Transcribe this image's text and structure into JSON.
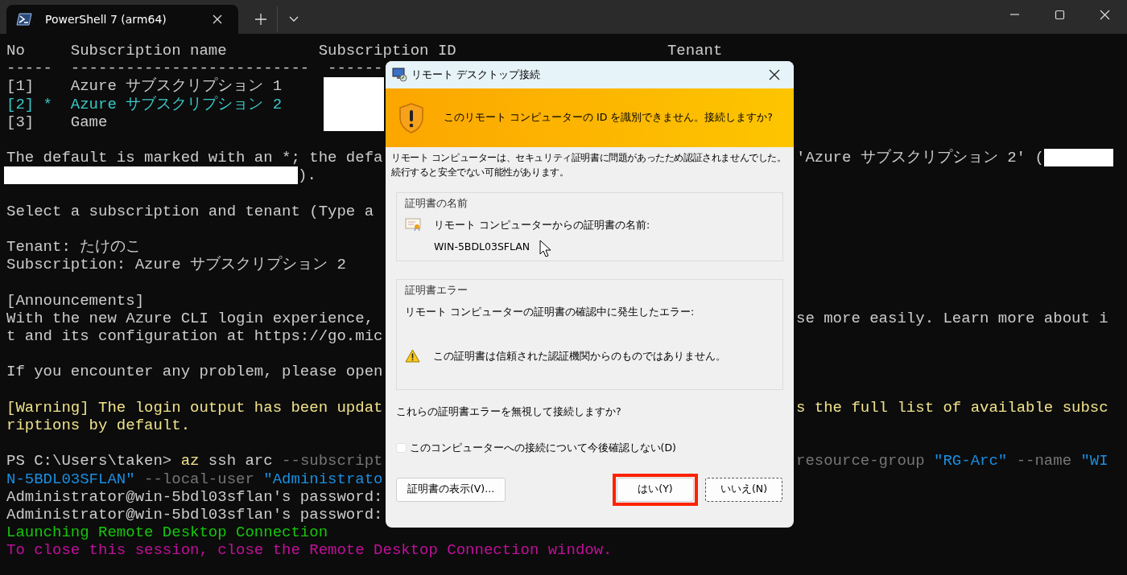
{
  "terminal": {
    "tabs": [
      {
        "title": "PowerShell 7 (arm64)",
        "selected": true
      }
    ],
    "blocks": [
      [
        {
          "left": [
            {
              "kind": "text",
              "color": "#cccccc",
              "text": "No     Subscription name          Subscription ID                       Tenant"
            }
          ]
        },
        {
          "left": [
            {
              "kind": "text",
              "color": "#cccccc",
              "text": "-----  --------------------------  ------"
            }
          ]
        },
        {
          "left": [
            {
              "kind": "text",
              "color": "#cccccc",
              "text": "[1]    Azure サブスクリプション 1"
            }
          ]
        },
        {
          "left": [
            {
              "kind": "text",
              "color": "#3ac8c8",
              "text": "[2] *  Azure サブスクリプション 2"
            }
          ]
        },
        {
          "left": [
            {
              "kind": "text",
              "color": "#cccccc",
              "text": "[3]    Game"
            }
          ]
        }
      ],
      [
        {
          "left": [
            {
              "kind": "text",
              "color": "#cccccc",
              "text": "The default is marked with an *; the defa"
            }
          ],
          "right": [
            {
              "kind": "text",
              "color": "#cccccc",
              "text": "'Azure サブスクリプション 2' ("
            },
            {
              "kind": "redaction"
            }
          ]
        },
        {
          "left": [
            {
              "kind": "redaction"
            },
            {
              "kind": "text",
              "color": "#cccccc",
              "text": ")."
            }
          ]
        }
      ],
      [
        {
          "left": [
            {
              "kind": "text",
              "color": "#cccccc",
              "text": "Select a subscription and tenant (Type a"
            }
          ]
        }
      ],
      [
        {
          "left": [
            {
              "kind": "text",
              "color": "#cccccc",
              "text": "Tenant: たけのこ"
            }
          ]
        },
        {
          "left": [
            {
              "kind": "text",
              "color": "#cccccc",
              "text": "Subscription: Azure サブスクリプション 2"
            }
          ]
        }
      ],
      [
        {
          "left": [
            {
              "kind": "text",
              "color": "#cccccc",
              "text": "[Announcements]"
            }
          ]
        },
        {
          "left": [
            {
              "kind": "text",
              "color": "#cccccc",
              "text": "With the new Azure CLI login experience,"
            }
          ],
          "right": [
            {
              "kind": "text",
              "color": "#cccccc",
              "text": "se more easily. Learn more about i"
            }
          ]
        },
        {
          "left": [
            {
              "kind": "text",
              "color": "#cccccc",
              "text": "t and its configuration at https://go.mic"
            }
          ]
        }
      ],
      [
        {
          "left": [
            {
              "kind": "text",
              "color": "#cccccc",
              "text": "If you encounter any problem, please open"
            }
          ]
        }
      ],
      [
        {
          "left": [
            {
              "kind": "text",
              "color": "#f0e28c",
              "text": "[Warning] The login output has been updat"
            }
          ],
          "right": [
            {
              "kind": "text",
              "color": "#f0e28c",
              "text": "s the full list of available subsc"
            }
          ]
        },
        {
          "left": [
            {
              "kind": "text",
              "color": "#f0e28c",
              "text": "riptions by default."
            }
          ]
        }
      ],
      [
        {
          "left": [
            {
              "kind": "text",
              "color": "#cccccc",
              "text": "PS C:\\Users\\taken> "
            },
            {
              "kind": "text",
              "color": "#f0e28c",
              "text": "az"
            },
            {
              "kind": "text",
              "color": "#cccccc",
              "text": " ssh arc "
            },
            {
              "kind": "text",
              "color": "#767676",
              "text": "--subscript"
            }
          ],
          "right": [
            {
              "kind": "text",
              "color": "#767676",
              "text": "resource-group "
            },
            {
              "kind": "text",
              "color": "#1a8fe0",
              "text": "\"RG-Arc\""
            },
            {
              "kind": "text",
              "color": "#767676",
              "text": " --name "
            },
            {
              "kind": "text",
              "color": "#1a8fe0",
              "text": "\"WI"
            }
          ]
        },
        {
          "left": [
            {
              "kind": "text",
              "color": "#1a8fe0",
              "text": "N-5BDL03SFLAN\""
            },
            {
              "kind": "text",
              "color": "#767676",
              "text": " --local-user "
            },
            {
              "kind": "text",
              "color": "#1a8fe0",
              "text": "\"Administrato"
            }
          ]
        },
        {
          "left": [
            {
              "kind": "text",
              "color": "#cccccc",
              "text": "Administrator@win-5bdl03sflan's password:"
            }
          ]
        },
        {
          "left": [
            {
              "kind": "text",
              "color": "#cccccc",
              "text": "Administrator@win-5bdl03sflan's password:"
            }
          ]
        },
        {
          "left": [
            {
              "kind": "text",
              "color": "#16c60c",
              "text": "Launching Remote Desktop Connection"
            }
          ]
        },
        {
          "left": [
            {
              "kind": "text",
              "color": "#c0109a",
              "text": "To close this session, close the Remote Desktop Connection window."
            }
          ]
        }
      ]
    ]
  },
  "dialog": {
    "title": "リモート デスクトップ接続",
    "banner": "このリモート コンピューターの ID を識別できません。接続しますか?",
    "message": [
      "リモート コンピューターは、セキュリティ証明書に問題があったため認証されませんでした。",
      "続行すると安全でない可能性があります。"
    ],
    "cert_name": {
      "heading": "証明書の名前",
      "label": "リモート コンピューターからの証明書の名前:",
      "value": "WIN-5BDL03SFLAN"
    },
    "cert_errors": {
      "heading": "証明書エラー",
      "label": "リモート コンピューターの証明書の確認中に発生したエラー:",
      "errors": [
        "この証明書は信頼された認証機関からのものではありません。"
      ]
    },
    "question": "これらの証明書エラーを無視して接続しますか?",
    "checkbox": {
      "label": "このコンピューターへの接続について今後確認しない(D)",
      "checked": false
    },
    "view_button": "証明書の表示(V)...",
    "buttons": [
      {
        "label": "はい(Y)",
        "highlighted": true,
        "focused": false
      },
      {
        "label": "いいえ(N)",
        "highlighted": false,
        "focused": true
      }
    ]
  }
}
